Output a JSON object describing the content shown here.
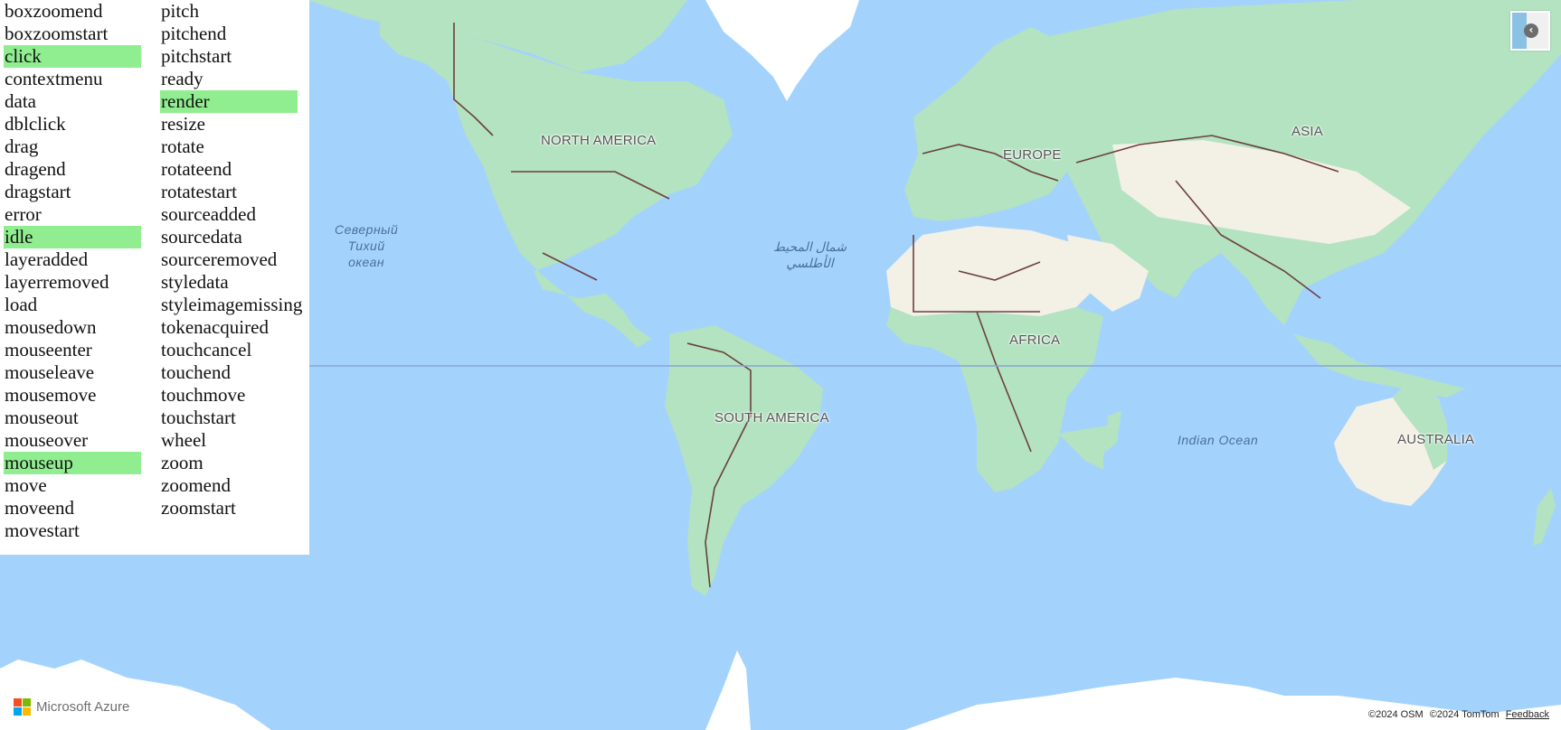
{
  "events": {
    "column_a": [
      {
        "label": "boxzoomend",
        "active": false
      },
      {
        "label": "boxzoomstart",
        "active": false
      },
      {
        "label": "click",
        "active": true
      },
      {
        "label": "contextmenu",
        "active": false
      },
      {
        "label": "data",
        "active": false
      },
      {
        "label": "dblclick",
        "active": false
      },
      {
        "label": "drag",
        "active": false
      },
      {
        "label": "dragend",
        "active": false
      },
      {
        "label": "dragstart",
        "active": false
      },
      {
        "label": "error",
        "active": false
      },
      {
        "label": "idle",
        "active": true
      },
      {
        "label": "layeradded",
        "active": false
      },
      {
        "label": "layerremoved",
        "active": false
      },
      {
        "label": "load",
        "active": false
      },
      {
        "label": "mousedown",
        "active": false
      },
      {
        "label": "mouseenter",
        "active": false
      },
      {
        "label": "mouseleave",
        "active": false
      },
      {
        "label": "mousemove",
        "active": false
      },
      {
        "label": "mouseout",
        "active": false
      },
      {
        "label": "mouseover",
        "active": false
      },
      {
        "label": "mouseup",
        "active": true
      },
      {
        "label": "move",
        "active": false
      },
      {
        "label": "moveend",
        "active": false
      },
      {
        "label": "movestart",
        "active": false
      }
    ],
    "column_b": [
      {
        "label": "pitch",
        "active": false
      },
      {
        "label": "pitchend",
        "active": false
      },
      {
        "label": "pitchstart",
        "active": false
      },
      {
        "label": "ready",
        "active": false
      },
      {
        "label": "render",
        "active": true
      },
      {
        "label": "resize",
        "active": false
      },
      {
        "label": "rotate",
        "active": false
      },
      {
        "label": "rotateend",
        "active": false
      },
      {
        "label": "rotatestart",
        "active": false
      },
      {
        "label": "sourceadded",
        "active": false
      },
      {
        "label": "sourcedata",
        "active": false
      },
      {
        "label": "sourceremoved",
        "active": false
      },
      {
        "label": "styledata",
        "active": false
      },
      {
        "label": "styleimagemissing",
        "active": false
      },
      {
        "label": "tokenacquired",
        "active": false
      },
      {
        "label": "touchcancel",
        "active": false
      },
      {
        "label": "touchend",
        "active": false
      },
      {
        "label": "touchmove",
        "active": false
      },
      {
        "label": "touchstart",
        "active": false
      },
      {
        "label": "wheel",
        "active": false
      },
      {
        "label": "zoom",
        "active": false
      },
      {
        "label": "zoomend",
        "active": false
      },
      {
        "label": "zoomstart",
        "active": false
      }
    ]
  },
  "map": {
    "labels": {
      "north_america": "NORTH AMERICA",
      "south_america": "SOUTH AMERICA",
      "europe": "EUROPE",
      "africa": "AFRICA",
      "asia": "ASIA",
      "australia": "AUSTRALIA",
      "north_pacific": "Северный\nТихий\nокеан",
      "north_atlantic": "شمال المحيط\nالأطلسي",
      "indian_ocean": "Indian Ocean"
    },
    "colors": {
      "ocean": "#a3d3fd",
      "land_green": "#b3e3c0",
      "land_desert": "#f3f0e6",
      "ice": "#ffffff",
      "border": "#6b3f3f",
      "highlight": "#90ee90"
    },
    "style_picker": {
      "icon": "chevron-left-icon"
    },
    "logo": {
      "text": "Microsoft Azure"
    },
    "attribution": {
      "osm": "©2024 OSM",
      "tomtom": "©2024 TomTom",
      "feedback": "Feedback"
    }
  }
}
